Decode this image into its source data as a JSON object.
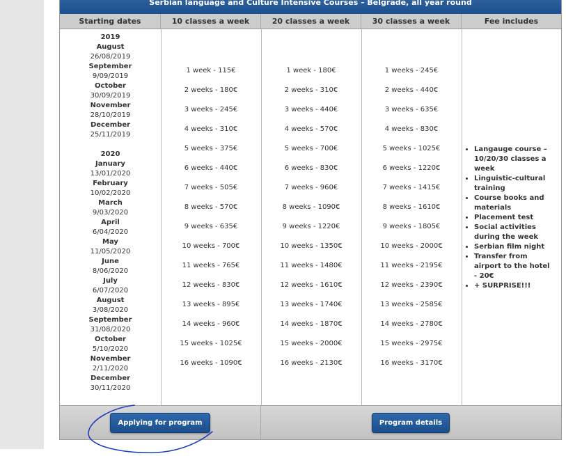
{
  "banner": {
    "title": "Serbian language and Culture Intensive Courses – Belgrade, all year round"
  },
  "columns": {
    "starting_dates": "Starting dates",
    "c10": "10 classes a week",
    "c20": "20 classes a week",
    "c30": "30 classes a week",
    "fee": "Fee includes"
  },
  "dates": {
    "y2019": "2019",
    "m0": "August",
    "d0": "26/08/2019",
    "m1": "September",
    "d1": "9/09/2019",
    "m2": "October",
    "d2": "30/09/2019",
    "m3": "November",
    "d3": "28/10/2019",
    "m4": "December",
    "d4": "25/11/2019",
    "y2020": "2020",
    "m5": "January",
    "d5": "13/01/2020",
    "m6": "February",
    "d6": "10/02/2020",
    "m7": "March",
    "d7": "9/03/2020",
    "m8": "April",
    "d8": "6/04/2020",
    "m9": "May",
    "d9": "11/05/2020",
    "m10": "June",
    "d10": "8/06/2020",
    "m11": "July",
    "d11": "6/07/2020",
    "m12": "August",
    "d12": "3/08/2020",
    "m13": "September",
    "d13": "31/08/2020",
    "m14": "October",
    "d14": "5/10/2020",
    "m15": "November",
    "d15": "2/11/2020",
    "m16": "December",
    "d16": "30/11/2020"
  },
  "prices10": [
    "1 week - 115€",
    "2 weeks - 180€",
    "3 weeks - 245€",
    "4 weeks - 310€",
    "5 weeks - 375€",
    "6 weeks - 440€",
    "7 weeks - 505€",
    "8 weeks - 570€",
    "9 weeks - 635€",
    "10 weeks - 700€",
    "11 weeks - 765€",
    "12 weeks - 830€",
    "13 weeks - 895€",
    "14 weeks - 960€",
    "15 weeks - 1025€",
    "16 weeks - 1090€"
  ],
  "prices20": [
    "1 week - 180€",
    "2 weeks - 310€",
    "3 weeks - 440€",
    "4 weeks - 570€",
    "5 weeks - 700€",
    "6 weeks - 830€",
    "7 weeks - 960€",
    "8 weeks - 1090€",
    "9 weeks - 1220€",
    "10 weeks - 1350€",
    "11 weeks - 1480€",
    "12 weeks - 1610€",
    "13 weeks - 1740€",
    "14 weeks - 1870€",
    "15 weeks - 2000€",
    "16 weeks - 2130€"
  ],
  "prices30": [
    "1 weeks - 245€",
    "2 weeks - 440€",
    "3 weeks - 635€",
    "4 weeks - 830€",
    "5 weeks - 1025€",
    "6 weeks - 1220€",
    "7 weeks - 1415€",
    "8 weeks - 1610€",
    "9 weeks - 1805€",
    "10 weeks - 2000€",
    "11 weeks - 2195€",
    "12 weeks - 2390€",
    "13 weeks - 2585€",
    "14 weeks - 2780€",
    "15 weeks - 2975€",
    "16 weeks - 3170€"
  ],
  "fee_items": [
    "Langauge course – 10/20/30 classes a week",
    "Linguistic-cultural training",
    "Course books and materials",
    "Placement test",
    "Social activities during the week",
    "Serbian film night",
    "Transfer from airport to the hotel - 20€",
    "+ SURPRISE!!!"
  ],
  "buttons": {
    "apply": "Applying for program",
    "details": "Program details"
  },
  "annotation_color": "#1f3fb8"
}
